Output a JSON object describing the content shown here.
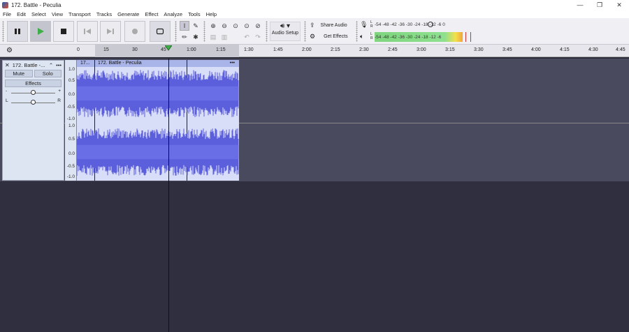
{
  "window": {
    "title": "172. Battle - Peculia",
    "minimize": "—",
    "maximize": "❐",
    "close": "✕"
  },
  "menu": [
    "File",
    "Edit",
    "Select",
    "View",
    "Transport",
    "Tracks",
    "Generate",
    "Effect",
    "Analyze",
    "Tools",
    "Help"
  ],
  "toolbar": {
    "audio_setup": "Audio Setup",
    "share_audio": "Share Audio",
    "get_effects": "Get Effects",
    "meter_scale": "-54  -48  -42  -36  -30  -24  -18  -12  -6  0",
    "meter_scale2": "-54  -48  -42  -36  -30  -24  -18  -12  -6",
    "rec_l": "L",
    "rec_r": "R",
    "play_l": "L",
    "play_r": "R"
  },
  "ruler": {
    "ticks": [
      "0",
      "15",
      "30",
      "45",
      "1:00",
      "1:15",
      "1:30",
      "1:45",
      "2:00",
      "2:15",
      "2:30",
      "2:45",
      "3:00",
      "3:15",
      "3:30",
      "3:45",
      "4:00",
      "4:15",
      "4:30",
      "4:45"
    ]
  },
  "track": {
    "name": "172. Battle -...",
    "mute": "Mute",
    "solo": "Solo",
    "effects": "Effects",
    "gain_minus": "-",
    "gain_plus": "+",
    "pan_l": "L",
    "pan_r": "R",
    "clip_short": "17...",
    "clip_name": "172. Battle - Peculia",
    "clip_menu": "•••",
    "scale": [
      "1.0",
      "0.5",
      "0.0",
      "-0.5",
      "-1.0"
    ]
  },
  "colors": {
    "waveform": "#5b5fdc",
    "clip_bg": "#d8def8",
    "track_bg": "#4a4a5e",
    "play": "#3fae49"
  }
}
